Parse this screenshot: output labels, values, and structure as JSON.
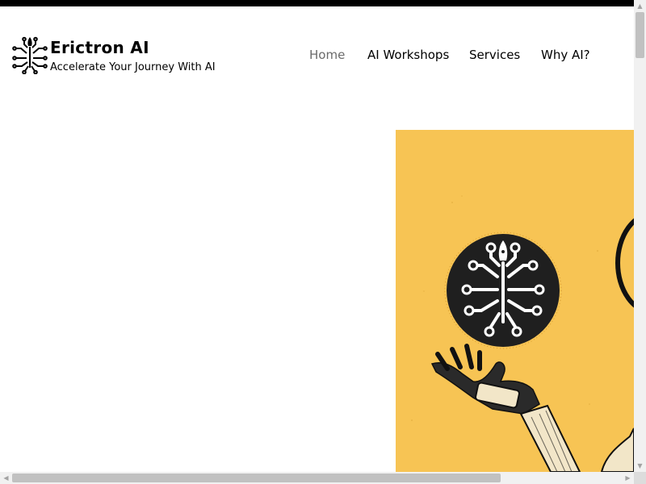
{
  "header": {
    "brand_name": "Erictron AI",
    "tagline": "Accelerate Your Journey With AI",
    "logo_icon": "circuit-tree-rocket-icon"
  },
  "nav": {
    "items": [
      {
        "label": "Home",
        "active": true
      },
      {
        "label": "AI Workshops",
        "active": false
      },
      {
        "label": "Services",
        "active": false
      },
      {
        "label": "Why AI?",
        "active": false
      }
    ]
  },
  "hero": {
    "image": "robot-hand-holding-circuit-emblem-illustration"
  },
  "scrollbars": {
    "up_arrow": "▲",
    "down_arrow": "▼",
    "left_arrow": "◀",
    "right_arrow": "▶"
  },
  "colors": {
    "hero_background": "#f7c454",
    "nav_active": "#6b6b6b",
    "text": "#000000"
  }
}
